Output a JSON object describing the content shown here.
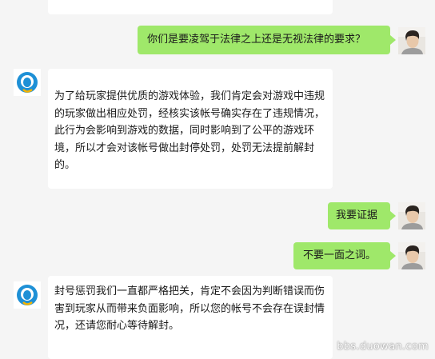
{
  "messages": [
    {
      "side": "in",
      "text": ""
    },
    {
      "side": "out",
      "text": "你们是要凌驾于法律之上还是无视法律的要求？"
    },
    {
      "side": "in",
      "text": "为了给玩家提供优质的游戏体验，我们肯定会对游戏中违规的玩家做出相应处罚，经核实该帐号确实存在了违规情况，此行为会影响到游戏的数据，同时影响到了公平的游戏环境，所以才会对该帐号做出封停处罚，处罚无法提前解封的。"
    },
    {
      "side": "out",
      "text": "我要证据"
    },
    {
      "side": "out",
      "text": "不要一面之词。"
    },
    {
      "side": "in",
      "text": "封号惩罚我们一直都严格把关，肯定不会因为判断错误而伤害到玩家从而带来负面影响，所以您的帐号不会存在误封情况，还请您耐心等待解封。"
    }
  ],
  "watermark": "bbs.duowan.com",
  "colors": {
    "outgoing_bubble": "#9fe86a",
    "incoming_bubble": "#ffffff",
    "background": "#f5f5f5",
    "agent_logo": "#1e90d6"
  },
  "icons": {
    "agent_avatar": "qq-penguin-logo-icon",
    "user_avatar": "user-photo-avatar"
  }
}
